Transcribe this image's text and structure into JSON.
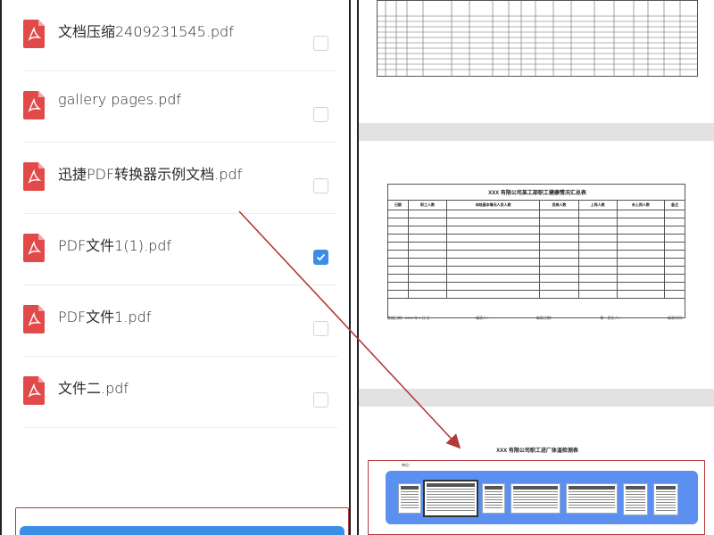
{
  "files": [
    {
      "name": "文档压缩2409231545.pdf",
      "checked": false
    },
    {
      "name": "gallery pages.pdf",
      "checked": false
    },
    {
      "name": "迅捷PDF转换器示例文档.pdf",
      "checked": false
    },
    {
      "name": "PDF文件1(1).pdf",
      "checked": true
    },
    {
      "name": "PDF文件1.pdf",
      "checked": false
    },
    {
      "name": "文件二.pdf",
      "checked": false
    }
  ],
  "preview": {
    "table_title": "XXX 有限公司某工部职工健康情况汇总表",
    "columns": [
      "日期",
      "职工人数",
      "体检基本情况人员人数",
      "发病人数",
      "上岗人数",
      "未上岗人数",
      "备注"
    ],
    "footer": [
      "数据日期：2009 年 1 日    日",
      "填表人：",
      "填表日期：",
      "第一责任人：",
      "填表时间："
    ],
    "bottom_title": "XXX 有限公司职工进厂体温检测表",
    "bottom_label": "单位："
  },
  "colors": {
    "accent_blue": "#3a8ee6",
    "pdf_red": "#e24a4a",
    "annotation_red": "#b23a3a",
    "strip_blue": "#5b8ff0"
  }
}
